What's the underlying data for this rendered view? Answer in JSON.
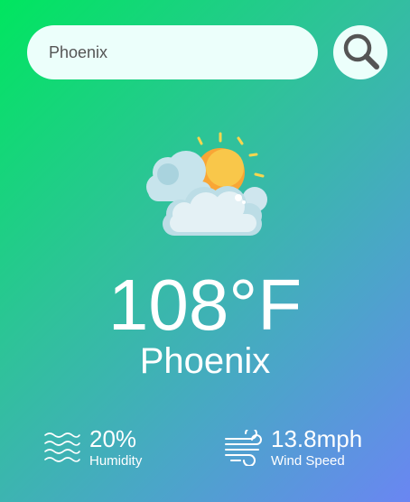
{
  "search": {
    "value": "Phoenix",
    "button_icon": "search-icon"
  },
  "weather": {
    "icon": "partly-cloudy-icon",
    "temperature": "108°F",
    "city": "Phoenix"
  },
  "details": {
    "humidity": {
      "icon": "humidity-icon",
      "value": "20%",
      "label": "Humidity"
    },
    "wind": {
      "icon": "wind-icon",
      "value": "13.8mph",
      "label": "Wind Speed"
    }
  },
  "colors": {
    "gradient_start": "#00e65f",
    "gradient_end": "#6a86f2",
    "input_background": "#ecfffb",
    "text": "#ffffff"
  }
}
